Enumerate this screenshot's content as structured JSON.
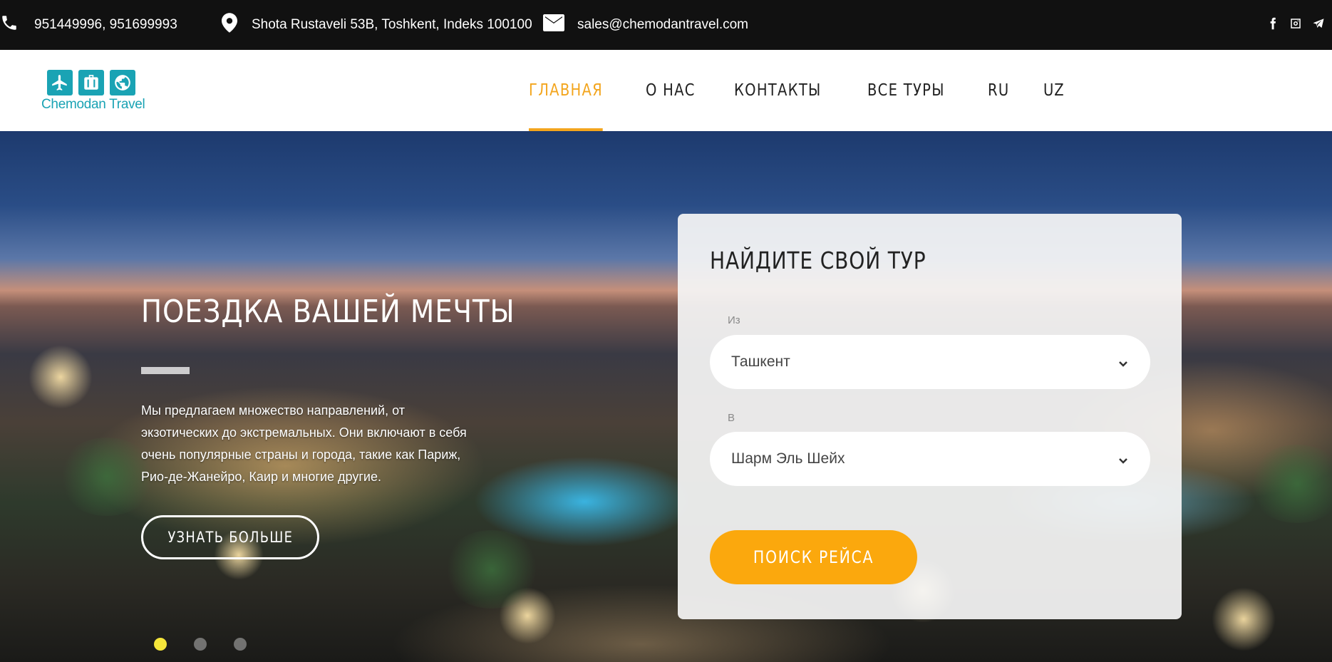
{
  "topbar": {
    "phones": "951449996,  951699993",
    "address": "Shota Rustaveli 53B, Toshkent, Indeks 100100",
    "email": "sales@chemodantravel.com",
    "social": [
      "facebook-icon",
      "instagram-icon",
      "telegram-icon"
    ]
  },
  "logo": {
    "text": "Chemodan Travel",
    "icons": [
      "airplane-icon",
      "suitcase-icon",
      "globe-icon"
    ],
    "color": "#1aa3b4"
  },
  "nav": {
    "items": [
      {
        "label": "ГЛАВНАЯ",
        "active": true
      },
      {
        "label": "О НАС",
        "active": false
      },
      {
        "label": "КОНТАКТЫ",
        "active": false
      },
      {
        "label": "ВСЕ ТУРЫ",
        "active": false
      },
      {
        "label": "RU",
        "active": false
      },
      {
        "label": "UZ",
        "active": false
      }
    ],
    "accent_color": "#f3a51d"
  },
  "hero": {
    "title": "ПОЕЗДКА ВАШЕЙ МЕЧТЫ",
    "description": "Мы предлагаем множество направлений, от экзотических до экстремальных. Они включают в себя очень популярные страны и города, такие как Париж, Рио-де-Жанейро, Каир и многие другие.",
    "button_label": "УЗНАТЬ БОЛЬШЕ",
    "slides_count": 3,
    "active_slide": 1
  },
  "search": {
    "title": "НАЙДИТЕ СВОЙ ТУР",
    "from_label": "Из",
    "from_value": "Ташкент",
    "to_label": "В",
    "to_value": "Шарм Эль Шейх",
    "button_label": "ПОИСК РЕЙСА",
    "button_color": "#fba80d"
  }
}
